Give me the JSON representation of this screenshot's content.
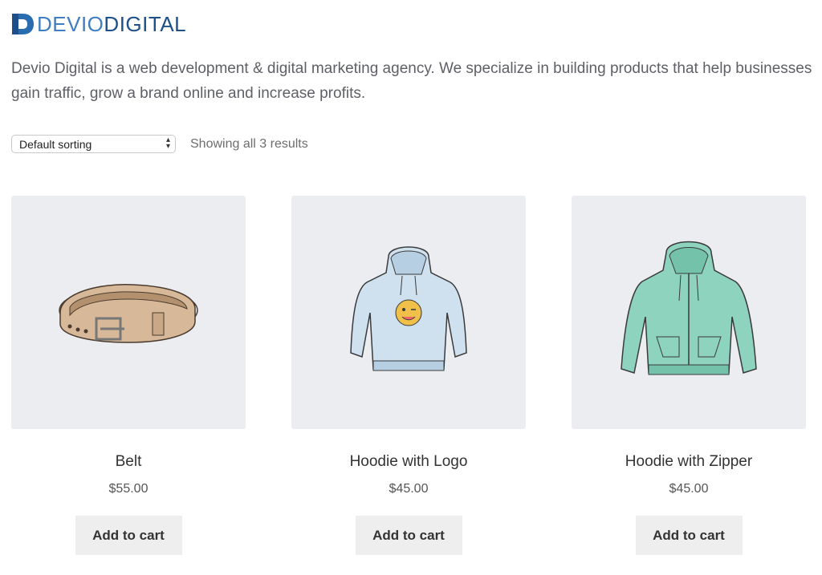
{
  "brand": {
    "light": "DEVIO",
    "dark": "DIGITAL",
    "colors": {
      "light": "#3f7fc1",
      "dark": "#1d4f8a"
    }
  },
  "intro": "Devio Digital is a web development & digital marketing agency. We specialize in building products that help businesses gain traffic, grow a brand online and increase profits.",
  "toolbar": {
    "sort_selected": "Default sorting",
    "result_count": "Showing all 3 results"
  },
  "products": [
    {
      "title": "Belt",
      "price": "$55.00",
      "button": "Add to cart",
      "image": "belt-image"
    },
    {
      "title": "Hoodie with Logo",
      "price": "$45.00",
      "button": "Add to cart",
      "image": "hoodie-logo-image"
    },
    {
      "title": "Hoodie with Zipper",
      "price": "$45.00",
      "button": "Add to cart",
      "image": "hoodie-zipper-image"
    }
  ]
}
